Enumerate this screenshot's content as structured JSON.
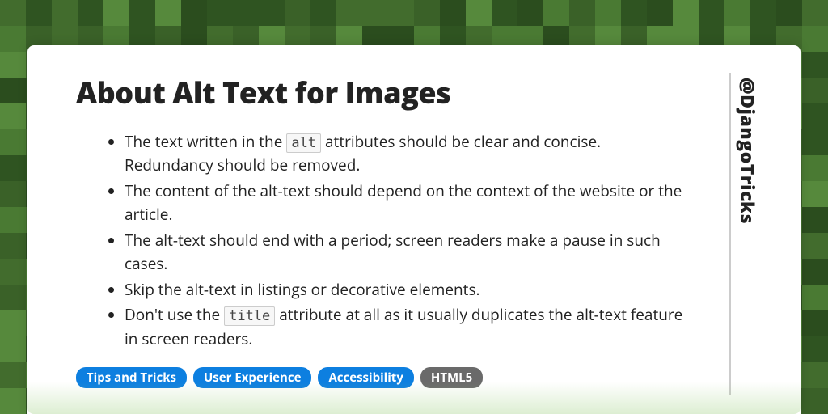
{
  "title": "About Alt Text for Images",
  "handle": "@DjangoTricks",
  "bullets": [
    {
      "pre": "The text written in the ",
      "code": "alt",
      "post": " attributes should be clear and concise. Redundancy should be removed."
    },
    {
      "text": "The content of the alt-text should depend on the context of the website or the article."
    },
    {
      "text": "The alt-text should end with a period; screen readers make a pause in such cases."
    },
    {
      "text": "Skip the alt-text in listings or decorative elements."
    },
    {
      "pre": "Don't use the ",
      "code": "title",
      "post": " attribute at all as it usually duplicates the alt-text feature in screen readers."
    }
  ],
  "tags": [
    {
      "label": "Tips and Tricks",
      "style": "blue"
    },
    {
      "label": "User Experience",
      "style": "blue"
    },
    {
      "label": "Accessibility",
      "style": "blue"
    },
    {
      "label": "HTML5",
      "style": "gray"
    }
  ],
  "bg_colors": [
    "#2b4d1e",
    "#3a6128",
    "#4a7a33",
    "#56893c",
    "#2f5421",
    "#426c2d"
  ]
}
